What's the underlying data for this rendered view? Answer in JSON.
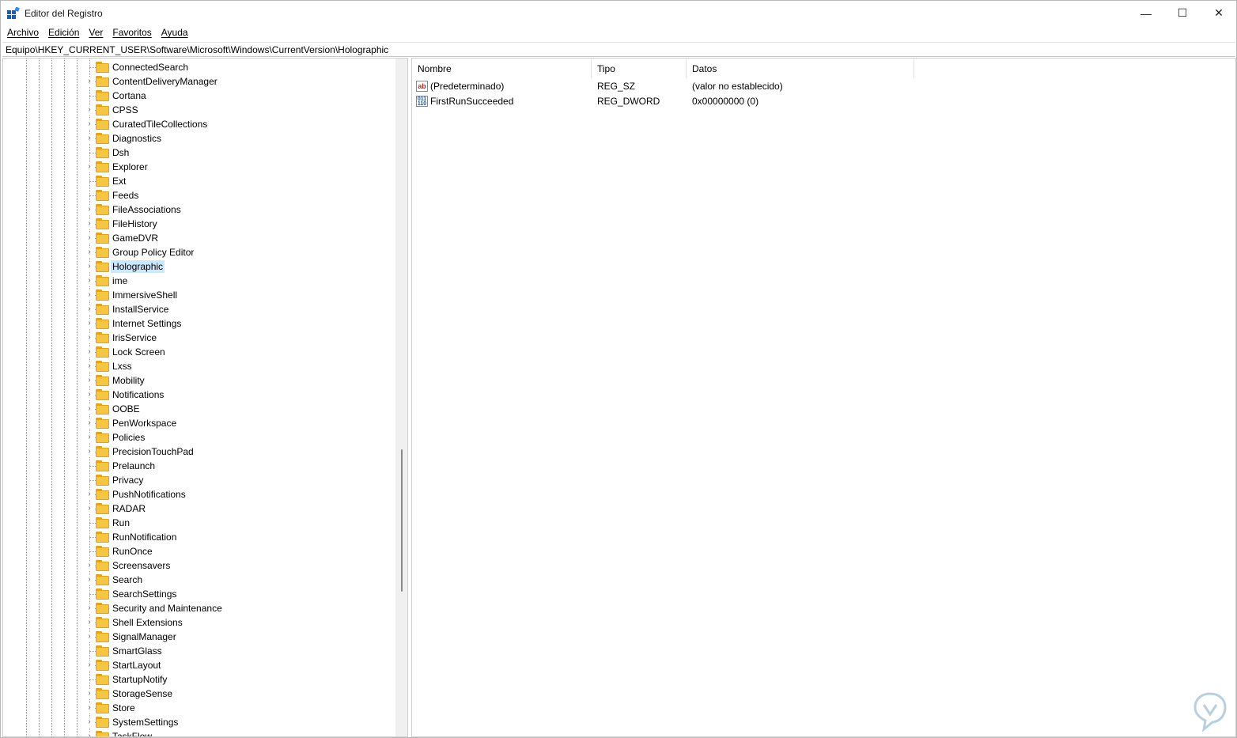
{
  "window": {
    "title": "Editor del Registro",
    "minimize_glyph": "—",
    "maximize_glyph": "☐",
    "close_glyph": "✕"
  },
  "menu": [
    "Archivo",
    "Edición",
    "Ver",
    "Favoritos",
    "Ayuda"
  ],
  "address": "Equipo\\HKEY_CURRENT_USER\\Software\\Microsoft\\Windows\\CurrentVersion\\Holographic",
  "tree": {
    "selected": "Holographic",
    "items": [
      {
        "label": "ConnectedSearch",
        "expandable": false
      },
      {
        "label": "ContentDeliveryManager",
        "expandable": true
      },
      {
        "label": "Cortana",
        "expandable": false
      },
      {
        "label": "CPSS",
        "expandable": true
      },
      {
        "label": "CuratedTileCollections",
        "expandable": true
      },
      {
        "label": "Diagnostics",
        "expandable": true
      },
      {
        "label": "Dsh",
        "expandable": false
      },
      {
        "label": "Explorer",
        "expandable": true
      },
      {
        "label": "Ext",
        "expandable": false
      },
      {
        "label": "Feeds",
        "expandable": false
      },
      {
        "label": "FileAssociations",
        "expandable": true
      },
      {
        "label": "FileHistory",
        "expandable": true
      },
      {
        "label": "GameDVR",
        "expandable": true
      },
      {
        "label": "Group Policy Editor",
        "expandable": true
      },
      {
        "label": "Holographic",
        "expandable": true
      },
      {
        "label": "ime",
        "expandable": true
      },
      {
        "label": "ImmersiveShell",
        "expandable": true
      },
      {
        "label": "InstallService",
        "expandable": true
      },
      {
        "label": "Internet Settings",
        "expandable": true
      },
      {
        "label": "IrisService",
        "expandable": true
      },
      {
        "label": "Lock Screen",
        "expandable": true
      },
      {
        "label": "Lxss",
        "expandable": true
      },
      {
        "label": "Mobility",
        "expandable": true
      },
      {
        "label": "Notifications",
        "expandable": true
      },
      {
        "label": "OOBE",
        "expandable": true
      },
      {
        "label": "PenWorkspace",
        "expandable": true
      },
      {
        "label": "Policies",
        "expandable": true
      },
      {
        "label": "PrecisionTouchPad",
        "expandable": true
      },
      {
        "label": "Prelaunch",
        "expandable": false
      },
      {
        "label": "Privacy",
        "expandable": false
      },
      {
        "label": "PushNotifications",
        "expandable": true
      },
      {
        "label": "RADAR",
        "expandable": true
      },
      {
        "label": "Run",
        "expandable": false
      },
      {
        "label": "RunNotification",
        "expandable": false
      },
      {
        "label": "RunOnce",
        "expandable": false
      },
      {
        "label": "Screensavers",
        "expandable": true
      },
      {
        "label": "Search",
        "expandable": true
      },
      {
        "label": "SearchSettings",
        "expandable": false
      },
      {
        "label": "Security and Maintenance",
        "expandable": true
      },
      {
        "label": "Shell Extensions",
        "expandable": true
      },
      {
        "label": "SignalManager",
        "expandable": true
      },
      {
        "label": "SmartGlass",
        "expandable": false
      },
      {
        "label": "StartLayout",
        "expandable": true
      },
      {
        "label": "StartupNotify",
        "expandable": false
      },
      {
        "label": "StorageSense",
        "expandable": true
      },
      {
        "label": "Store",
        "expandable": true
      },
      {
        "label": "SystemSettings",
        "expandable": true
      },
      {
        "label": "TaskFlow",
        "expandable": true
      }
    ]
  },
  "values": {
    "columns": {
      "name": "Nombre",
      "type": "Tipo",
      "data": "Datos"
    },
    "rows": [
      {
        "icon": "string-value-icon",
        "icon_text": "ab",
        "name": "(Predeterminado)",
        "type": "REG_SZ",
        "data": "(valor no establecido)"
      },
      {
        "icon": "binary-value-icon",
        "icon_text": "011\n110",
        "name": "FirstRunSucceeded",
        "type": "REG_DWORD",
        "data": "0x00000000 (0)"
      }
    ]
  },
  "colors": {
    "selection": "#cce8ff",
    "folder": "#f8c542",
    "folder_edge": "#e0a515"
  }
}
